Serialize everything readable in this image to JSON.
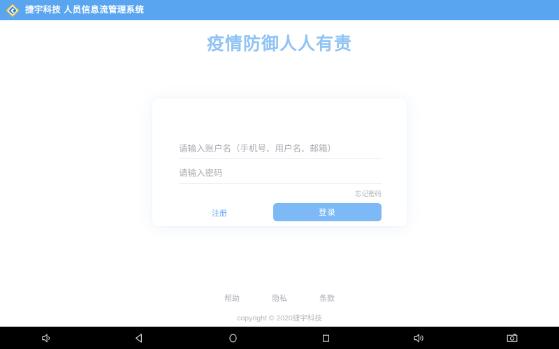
{
  "header": {
    "logo_icon": "company-diamond-logo",
    "title": "捷宇科技 人员信息流管理系统",
    "bg_color": "#59a5ef"
  },
  "hero": {
    "title": "疫情防御人人有责",
    "color": "#8fc3f4"
  },
  "login_form": {
    "username": {
      "value": "",
      "placeholder": "请输入账户名（手机号、用户名、邮箱）"
    },
    "password": {
      "value": "",
      "placeholder": "请输入密码"
    },
    "forgot_password_label": "忘记密码",
    "register_label": "注册",
    "login_label": "登录",
    "button_color": "#7cb9f6",
    "link_color": "#6aa9f0"
  },
  "footer": {
    "links": [
      {
        "label": "帮助"
      },
      {
        "label": "隐私"
      },
      {
        "label": "条款"
      }
    ],
    "copyright": "copyright © 2020捷宇科技"
  },
  "nav_bar": {
    "buttons": [
      {
        "name": "volume-down-icon",
        "label": "volume down"
      },
      {
        "name": "back-icon",
        "label": "back"
      },
      {
        "name": "home-icon",
        "label": "home"
      },
      {
        "name": "recents-icon",
        "label": "recent apps"
      },
      {
        "name": "volume-up-icon",
        "label": "volume up"
      },
      {
        "name": "screenshot-icon",
        "label": "screenshot"
      }
    ]
  }
}
